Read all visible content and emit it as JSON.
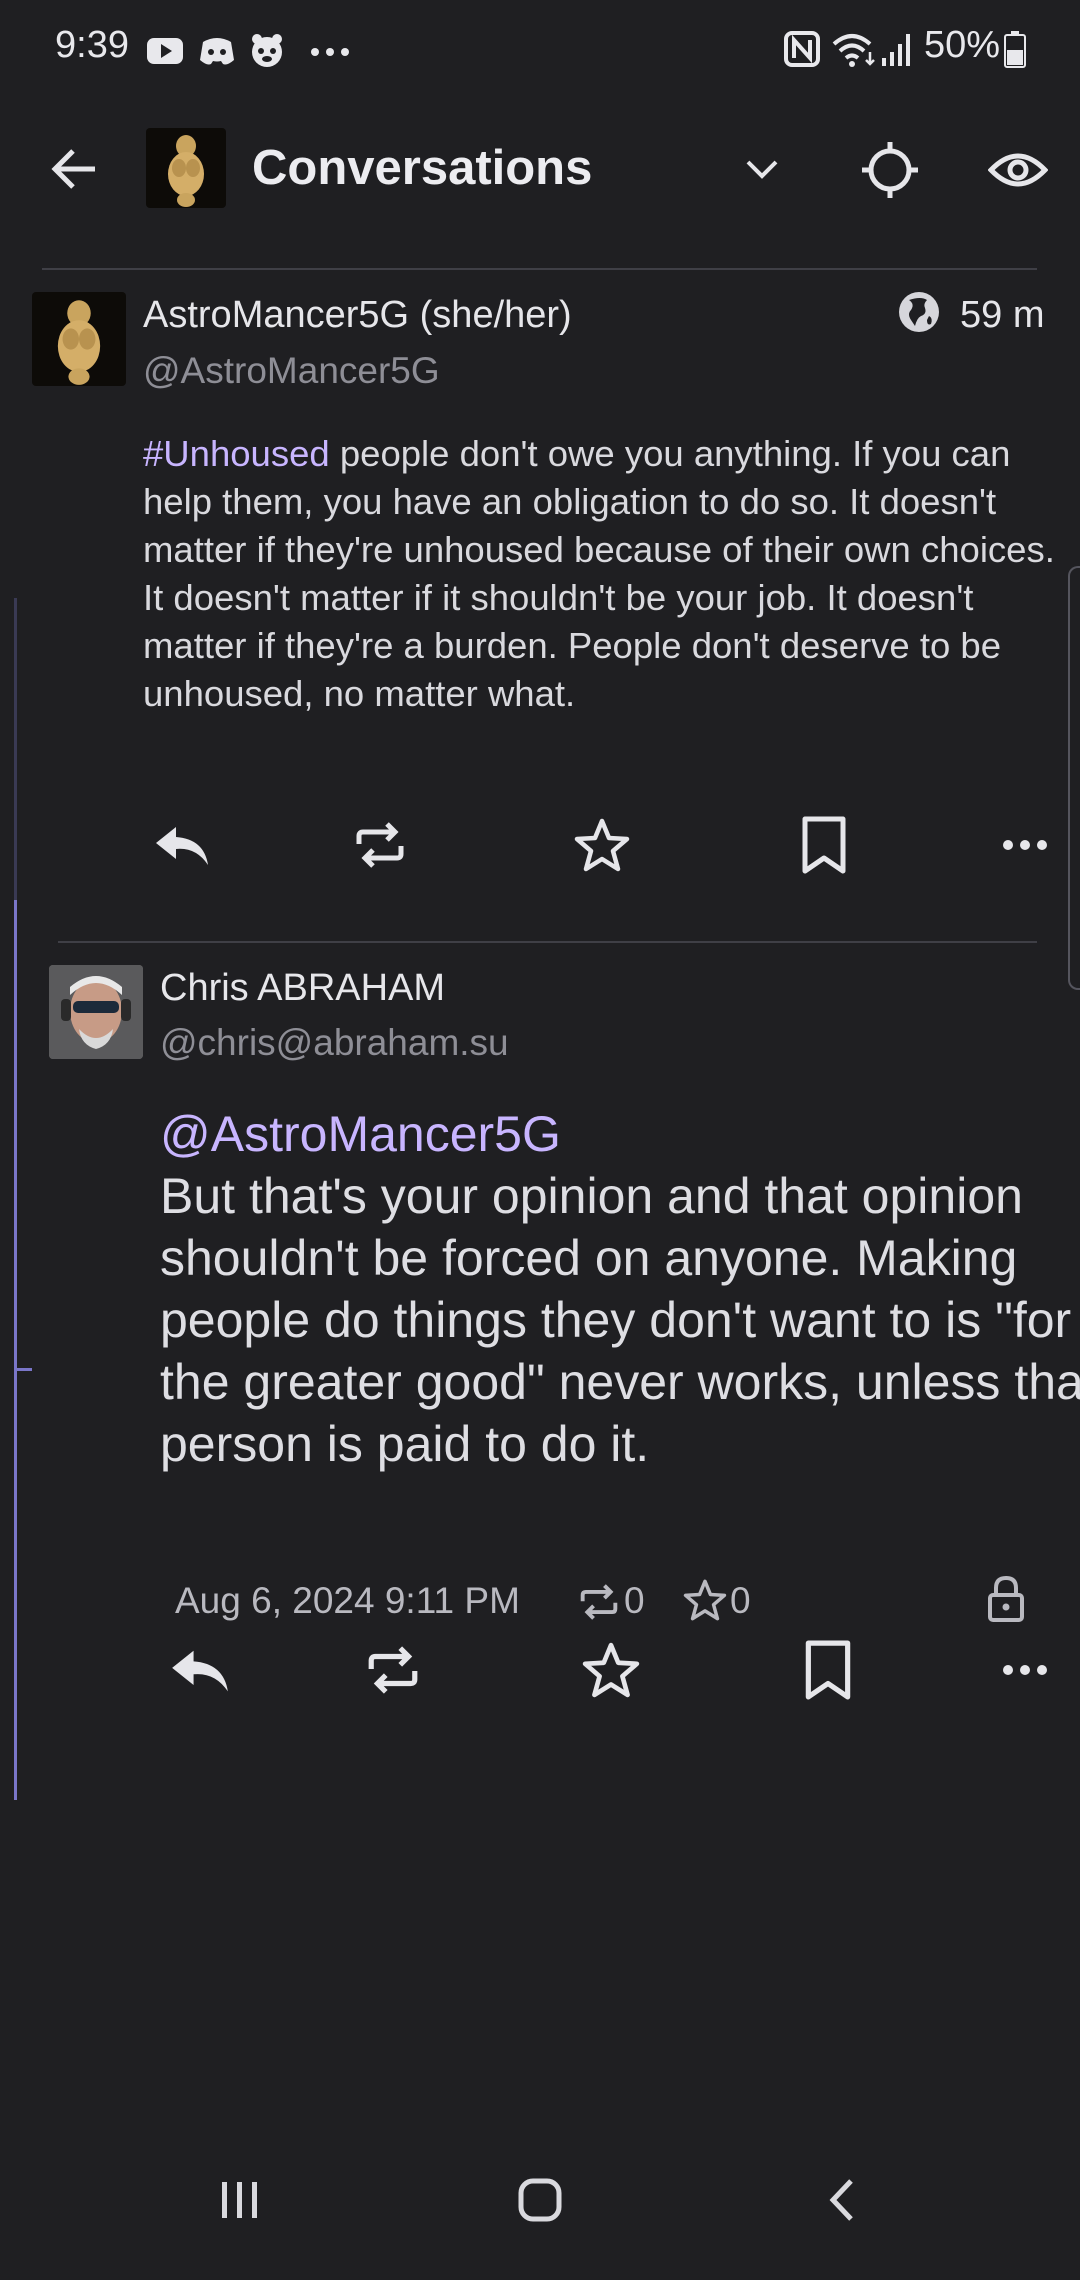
{
  "status_bar": {
    "time": "9:39",
    "left_icons": [
      "youtube-icon",
      "discord-icon",
      "mastodon-icon",
      "more-dots-icon"
    ],
    "right_icons": [
      "nfc-icon",
      "wifi-icon",
      "signal-icon",
      "battery-icon"
    ],
    "battery": "50%"
  },
  "toolbar": {
    "title": "Conversations",
    "icons": [
      "back-arrow-icon",
      "account-avatar",
      "chevron-down-icon",
      "crosshair-icon",
      "eye-icon"
    ]
  },
  "posts": [
    {
      "display_name": "AstroMancer5G (she/her)",
      "handle": "@AstroMancer5G",
      "visibility_icon": "globe-icon",
      "relative_time": "59 m",
      "hashtag": "#Unhoused",
      "body": " people don't owe you anything. If you can help them, you have an obligation to do so. It doesn't matter if they're unhoused because of their own choices. It doesn't matter if it shouldn't be your job. It doesn't matter if they're a burden. People don't deserve to be unhoused, no matter what."
    },
    {
      "display_name": "Chris ABRAHAM",
      "handle": "@chris@abraham.su",
      "mention": "@AstroMancer5G",
      "body": "But that's your opinion and that opinion shouldn't be forced on anyone. Making people do things they don't want to is \"for the greater good\" never works, unless that person is paid to do it.",
      "timestamp": "Aug 6, 2024 9:11 PM",
      "boosts": "0",
      "favourites": "0",
      "visibility_icon": "lock-icon"
    }
  ],
  "actions": [
    "reply-icon",
    "boost-icon",
    "favourite-icon",
    "bookmark-icon",
    "more-icon"
  ],
  "nav_bar": [
    "recents-icon",
    "home-icon",
    "back-icon"
  ]
}
